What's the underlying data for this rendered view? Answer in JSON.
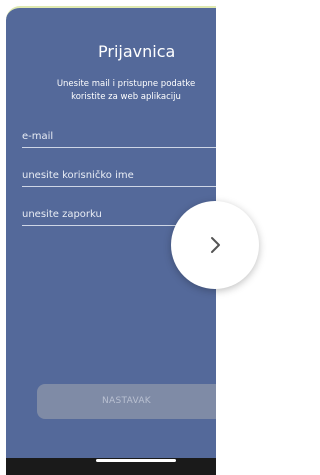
{
  "header": {
    "title": "Prijavnica"
  },
  "intro": {
    "text": "Unesite mail i pristupne podatke\nkoristite za web aplikaciju"
  },
  "form": {
    "email_placeholder": "e-mail",
    "username_placeholder": "unesite korisničko ime",
    "password_placeholder": "unesite zaporku",
    "submit_label": "NASTAVAK"
  },
  "carousel": {
    "next_icon": "chevron-right-icon"
  },
  "colors": {
    "screen_bg": "#54699a",
    "button_bg": "#7f8ba6",
    "top_accent": "#dfe9b0"
  }
}
